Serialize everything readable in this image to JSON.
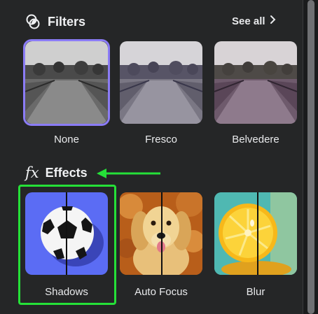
{
  "filters": {
    "title": "Filters",
    "see_all": "See all",
    "items": [
      {
        "label": "None"
      },
      {
        "label": "Fresco"
      },
      {
        "label": "Belvedere"
      }
    ]
  },
  "effects": {
    "title": "Effects",
    "items": [
      {
        "label": "Shadows"
      },
      {
        "label": "Auto Focus"
      },
      {
        "label": "Blur"
      }
    ]
  },
  "icons": {
    "filters": "filters-icon",
    "effects": "fx-icon",
    "see_all": "chevron-right-icon",
    "annotation": "arrow-left-icon"
  },
  "colors": {
    "background": "#252627",
    "selected": "#8b7cf6",
    "annotation": "#25e038",
    "shadows_bg": "#5b6cf4",
    "blur_bg": "#4fb8b2"
  }
}
